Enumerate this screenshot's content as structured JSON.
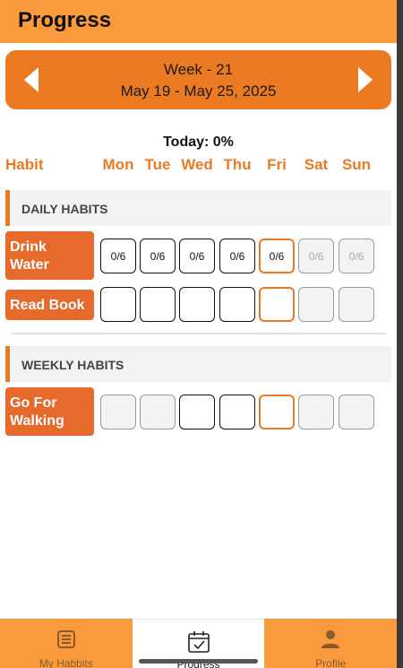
{
  "header": {
    "title": "Progress"
  },
  "week": {
    "label": "Week - 21",
    "range": "May 19 - May 25, 2025"
  },
  "today": "Today: 0%",
  "columns": {
    "habit": "Habit",
    "days": [
      "Mon",
      "Tue",
      "Wed",
      "Thu",
      "Fri",
      "Sat",
      "Sun"
    ]
  },
  "sections": {
    "daily": "DAILY HABITS",
    "weekly": "WEEKLY HABITS"
  },
  "habits": {
    "drink_water": {
      "name": "Drink Water",
      "cells": [
        "0/6",
        "0/6",
        "0/6",
        "0/6",
        "0/6",
        "0/6",
        "0/6"
      ]
    },
    "read_book": {
      "name": "Read Book"
    },
    "go_walking": {
      "name": "Go For Walking"
    }
  },
  "nav": {
    "items": [
      {
        "label": "My Habbits",
        "icon": "list-icon"
      },
      {
        "label": "Progress",
        "icon": "calendar-check-icon"
      },
      {
        "label": "Profile",
        "icon": "person-icon"
      }
    ],
    "active": "Progress"
  },
  "colors": {
    "accent": "#ec7a22",
    "header": "#f99a3c",
    "habit_tag": "#e66a2c",
    "section_bg": "#f2f2f2"
  }
}
